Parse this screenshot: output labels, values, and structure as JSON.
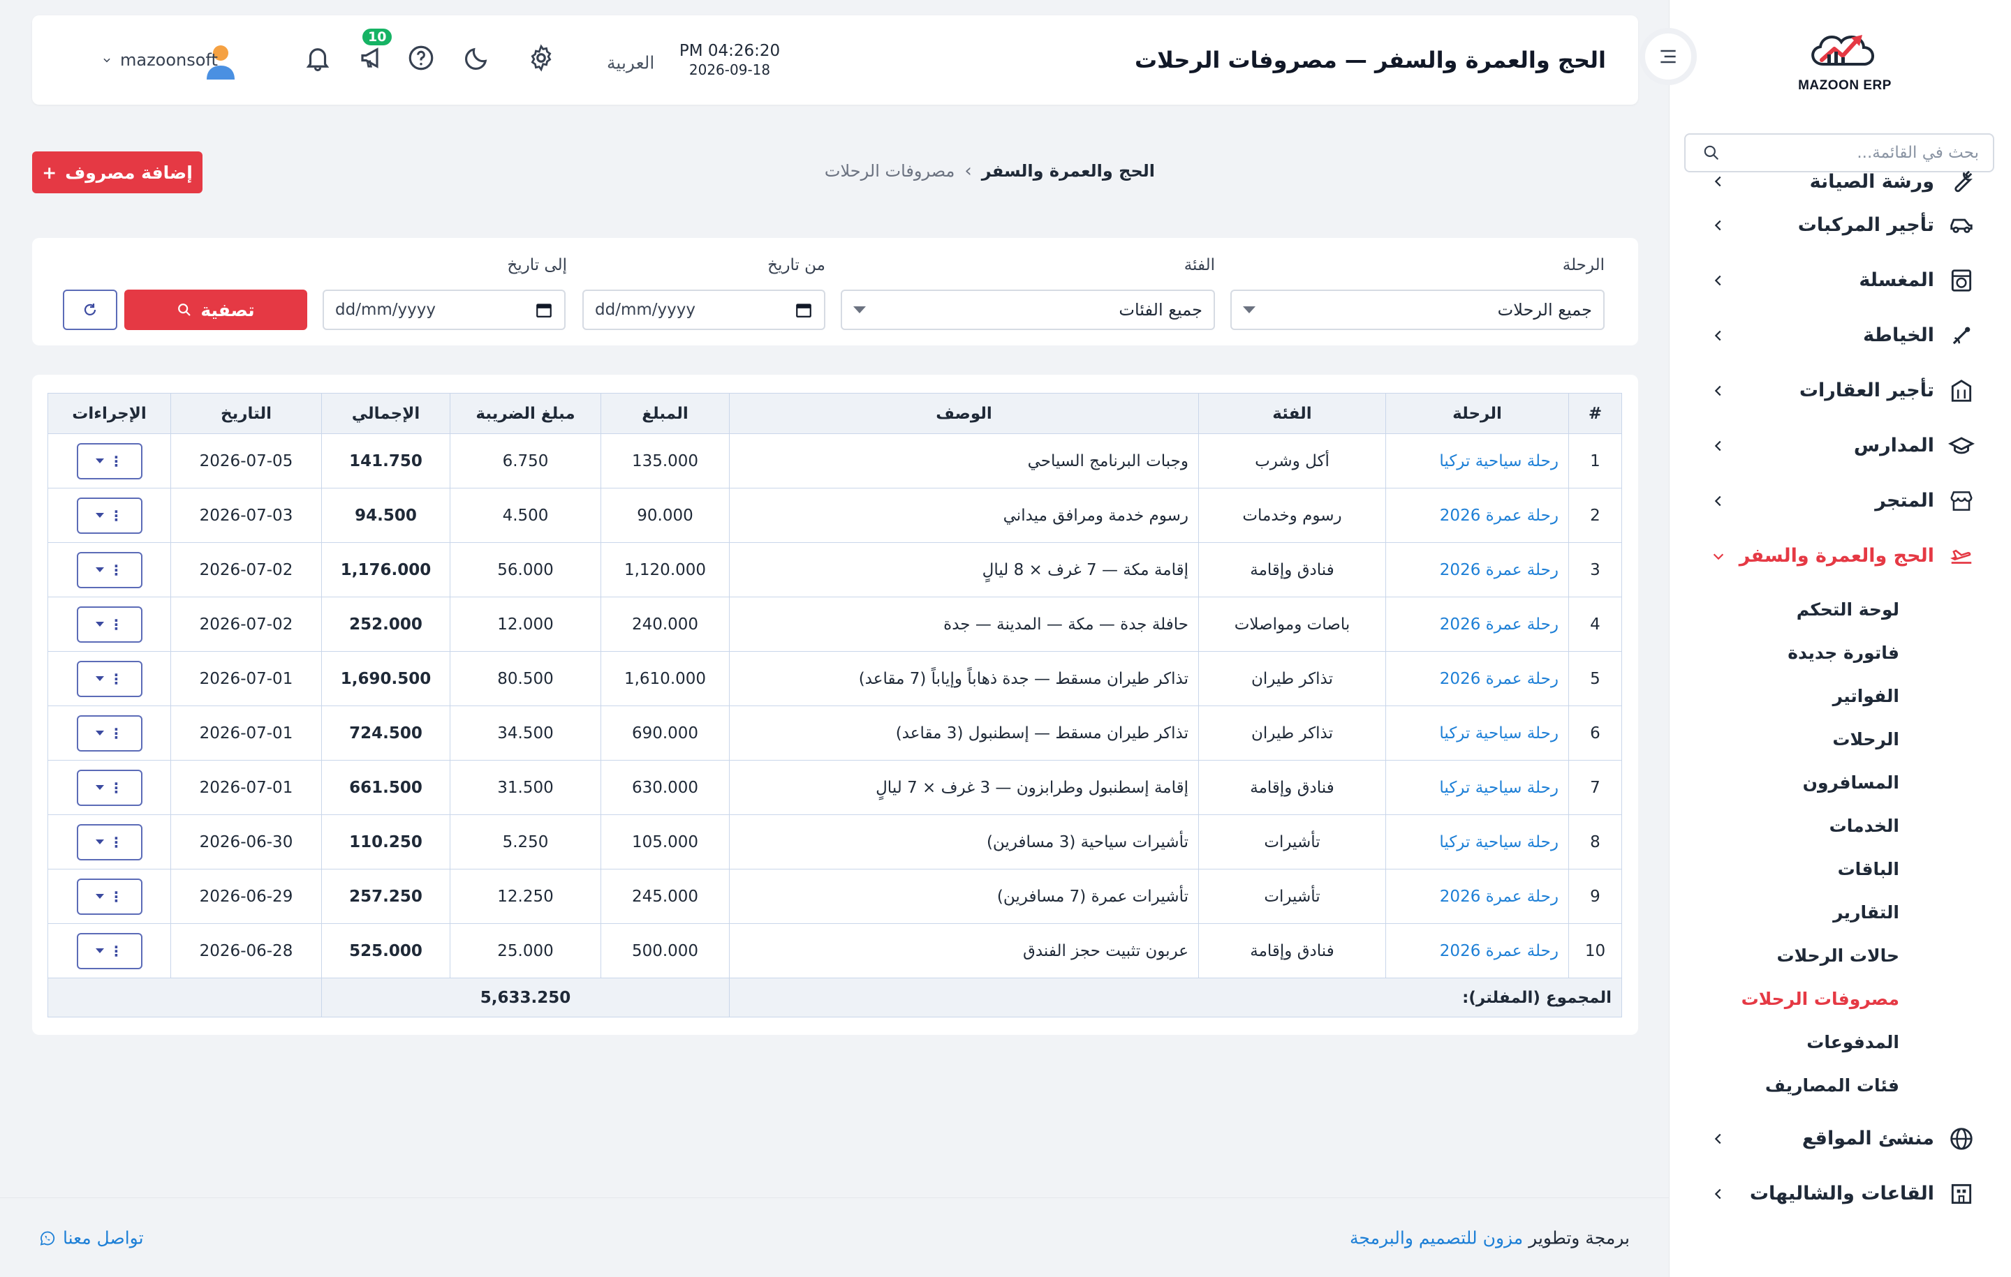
{
  "brand": {
    "name": "MAZOON ERP",
    "accent": "#e53944",
    "link": "#1d7fd6"
  },
  "sidebar": {
    "search_placeholder": "بحث في القائمة...",
    "items": [
      {
        "label": "ورشة الصيانة",
        "icon": "wrench-icon"
      },
      {
        "label": "تأجير المركبات",
        "icon": "car-icon"
      },
      {
        "label": "المغسلة",
        "icon": "washer-icon"
      },
      {
        "label": "الخياطة",
        "icon": "sewing-icon"
      },
      {
        "label": "تأجير العقارات",
        "icon": "building-icon"
      },
      {
        "label": "المدارس",
        "icon": "graduation-cap-icon"
      },
      {
        "label": "المتجر",
        "icon": "store-icon"
      },
      {
        "label": "الحج والعمرة والسفر",
        "icon": "plane-icon"
      }
    ],
    "submenu": [
      "لوحة التحكم",
      "فاتورة جديدة",
      "الفواتير",
      "الرحلات",
      "المسافرون",
      "الخدمات",
      "الباقات",
      "التقارير",
      "حالات الرحلات",
      "مصروفات الرحلات",
      "المدفوعات",
      "فئات المصاريف"
    ],
    "bottom_items": [
      {
        "label": "منشئ المواقع",
        "icon": "globe-icon"
      },
      {
        "label": "القاعات والشاليهات",
        "icon": "hall-icon"
      }
    ]
  },
  "header": {
    "title": "الحج والعمرة والسفر — مصروفات الرحلات",
    "time": "PM 04:26:20",
    "date": "2026-09-18",
    "language": "العربية",
    "notification_count": "10",
    "username": "mazoonsoft"
  },
  "breadcrumb": {
    "root": "الحج والعمرة والسفر",
    "separator": "›",
    "current": "مصروفات الرحلات"
  },
  "add_button": {
    "plus": "+",
    "label": "إضافة مصروف"
  },
  "filters": {
    "trip": {
      "label": "الرحلة",
      "value": "جميع الرحلات"
    },
    "category": {
      "label": "الفئة",
      "value": "جميع الفئات"
    },
    "from": {
      "label": "من تاريخ",
      "placeholder": "dd/mm/yyyy"
    },
    "to": {
      "label": "إلى تاريخ",
      "placeholder": "dd/mm/yyyy"
    },
    "filter_label": "تصفية"
  },
  "table": {
    "headers": [
      "#",
      "الرحلة",
      "الفئة",
      "الوصف",
      "المبلغ",
      "مبلغ الضريبة",
      "الإجمالي",
      "التاريخ",
      "الإجراءات"
    ],
    "rows": [
      {
        "n": "1",
        "trip": "رحلة سياحية تركيا",
        "category": "أكل وشرب",
        "desc": "وجبات البرنامج السياحي",
        "amount": "135.000",
        "tax": "6.750",
        "total": "141.750",
        "date": "2026-07-05"
      },
      {
        "n": "2",
        "trip": "رحلة عمرة 2026",
        "category": "رسوم وخدمات",
        "desc": "رسوم خدمة ومرافق ميداني",
        "amount": "90.000",
        "tax": "4.500",
        "total": "94.500",
        "date": "2026-07-03"
      },
      {
        "n": "3",
        "trip": "رحلة عمرة 2026",
        "category": "فنادق وإقامة",
        "desc": "إقامة مكة — 7 غرف × 8 ليالٍ",
        "amount": "1,120.000",
        "tax": "56.000",
        "total": "1,176.000",
        "date": "2026-07-02"
      },
      {
        "n": "4",
        "trip": "رحلة عمرة 2026",
        "category": "باصات ومواصلات",
        "desc": "حافلة جدة — مكة — المدينة — جدة",
        "amount": "240.000",
        "tax": "12.000",
        "total": "252.000",
        "date": "2026-07-02"
      },
      {
        "n": "5",
        "trip": "رحلة عمرة 2026",
        "category": "تذاكر طيران",
        "desc": "تذاكر طيران مسقط — جدة ذهاباً وإياباً (7 مقاعد)",
        "amount": "1,610.000",
        "tax": "80.500",
        "total": "1,690.500",
        "date": "2026-07-01"
      },
      {
        "n": "6",
        "trip": "رحلة سياحية تركيا",
        "category": "تذاكر طيران",
        "desc": "تذاكر طيران مسقط — إسطنبول (3 مقاعد)",
        "amount": "690.000",
        "tax": "34.500",
        "total": "724.500",
        "date": "2026-07-01"
      },
      {
        "n": "7",
        "trip": "رحلة سياحية تركيا",
        "category": "فنادق وإقامة",
        "desc": "إقامة إسطنبول وطرابزون — 3 غرف × 7 ليالٍ",
        "amount": "630.000",
        "tax": "31.500",
        "total": "661.500",
        "date": "2026-07-01"
      },
      {
        "n": "8",
        "trip": "رحلة سياحية تركيا",
        "category": "تأشيرات",
        "desc": "تأشيرات سياحية (3 مسافرين)",
        "amount": "105.000",
        "tax": "5.250",
        "total": "110.250",
        "date": "2026-06-30"
      },
      {
        "n": "9",
        "trip": "رحلة عمرة 2026",
        "category": "تأشيرات",
        "desc": "تأشيرات عمرة (7 مسافرين)",
        "amount": "245.000",
        "tax": "12.250",
        "total": "257.250",
        "date": "2026-06-29"
      },
      {
        "n": "10",
        "trip": "رحلة عمرة 2026",
        "category": "فنادق وإقامة",
        "desc": "عربون تثبيت حجز الفندق",
        "amount": "500.000",
        "tax": "25.000",
        "total": "525.000",
        "date": "2026-06-28"
      }
    ],
    "actions_symbol": "⋮",
    "sum_label": "المجموع (المفلتر):",
    "sum_total": "5,633.250"
  },
  "footer": {
    "credit_prefix": "برمجة وتطوير",
    "credit_link": "مزون للتصميم والبرمجة",
    "contact": "تواصل معنا"
  }
}
